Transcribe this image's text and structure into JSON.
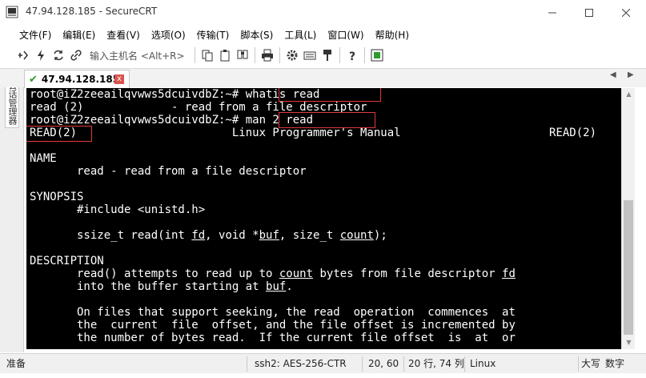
{
  "window": {
    "title": "47.94.128.185 - SecureCRT",
    "minimize_glyph": "—",
    "maximize_glyph": "☐",
    "close_glyph": "✕"
  },
  "menu": [
    "文件(F)",
    "编辑(E)",
    "查看(V)",
    "选项(O)",
    "传输(T)",
    "脚本(S)",
    "工具(L)",
    "窗口(W)",
    "帮助(H)"
  ],
  "toolbar": {
    "host_placeholder": "输入主机名 <Alt+R>"
  },
  "sidebar": {
    "label": "会话管理器"
  },
  "tab": {
    "label": "47.94.128.185",
    "check": "✔",
    "close": "x",
    "nav_left": "◀",
    "nav_right": "▶"
  },
  "terminal": {
    "lines": [
      "root@iZ2zeeailqvwws5dcuivdbZ:~# whatis read",
      "read (2)             - read from a file descriptor",
      "root@iZ2zeeailqvwws5dcuivdbZ:~# man 2 read",
      "READ(2)                       Linux Programmer's Manual                      READ(2)",
      "",
      "NAME",
      "       read - read from a file descriptor",
      "",
      "SYNOPSIS",
      "       #include <unistd.h>",
      "",
      "       ssize_t read(int fd, void *buf, size_t count);",
      "",
      "DESCRIPTION",
      "       read() attempts to read up to count bytes from file descriptor fd",
      "       into the buffer starting at buf.",
      "",
      "       On files that support seeking, the read  operation  commences  at",
      "       the  current  file  offset, and the file offset is incremented by",
      "       the number of bytes read.  If the current file offset  is  at  or"
    ]
  },
  "statusbar": {
    "ready": "准备",
    "cipher": "ssh2: AES-256-CTR",
    "cursor": "20,  60",
    "rows_cols": "20 行, 74 列",
    "term_type": "Linux",
    "caps": "大写",
    "num": "数字"
  },
  "colors": {
    "terminal_bg": "#000000",
    "terminal_fg": "#ffffff",
    "highlight_box": "#e23a3a",
    "tab_check": "#2e9b2e",
    "tab_close": "#d9534f"
  }
}
